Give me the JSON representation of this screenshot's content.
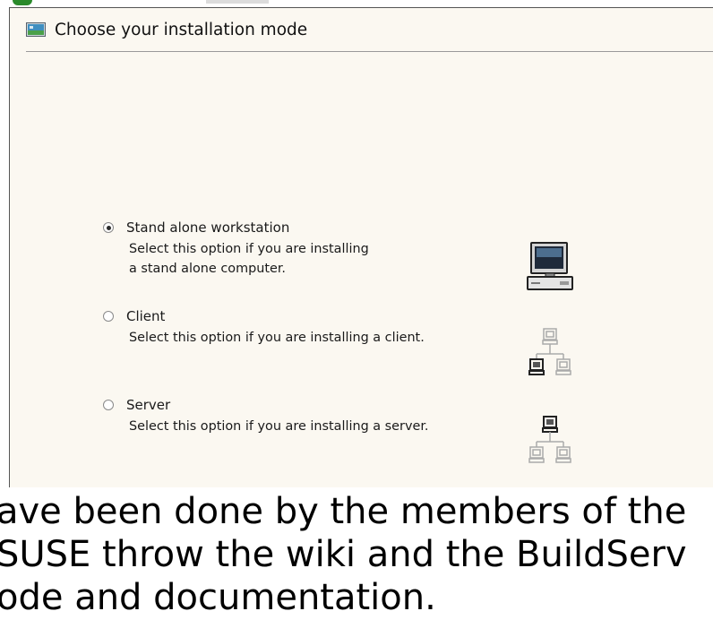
{
  "dialog": {
    "title": "Choose your installation mode",
    "header_icon": "monitor-installer-icon"
  },
  "options": [
    {
      "label": "Stand alone workstation",
      "description_lines": [
        "Select this option if you are installing",
        "a stand alone computer."
      ],
      "selected": true,
      "icon": "standalone-computer-icon"
    },
    {
      "label": "Client",
      "description_lines": [
        "Select this option if you are installing a client."
      ],
      "selected": false,
      "icon": "network-client-icon"
    },
    {
      "label": "Server",
      "description_lines": [
        "Select this option if you are installing a server."
      ],
      "selected": false,
      "icon": "network-server-icon"
    }
  ],
  "overlay_text": {
    "line1": "ave been done by the members of the",
    "line2": "SUSE throw the wiki and the BuildServ",
    "line3": "ode and documentation."
  },
  "colors": {
    "window_bg": "#fbf8f1",
    "accent_green": "#2a8a2a"
  }
}
